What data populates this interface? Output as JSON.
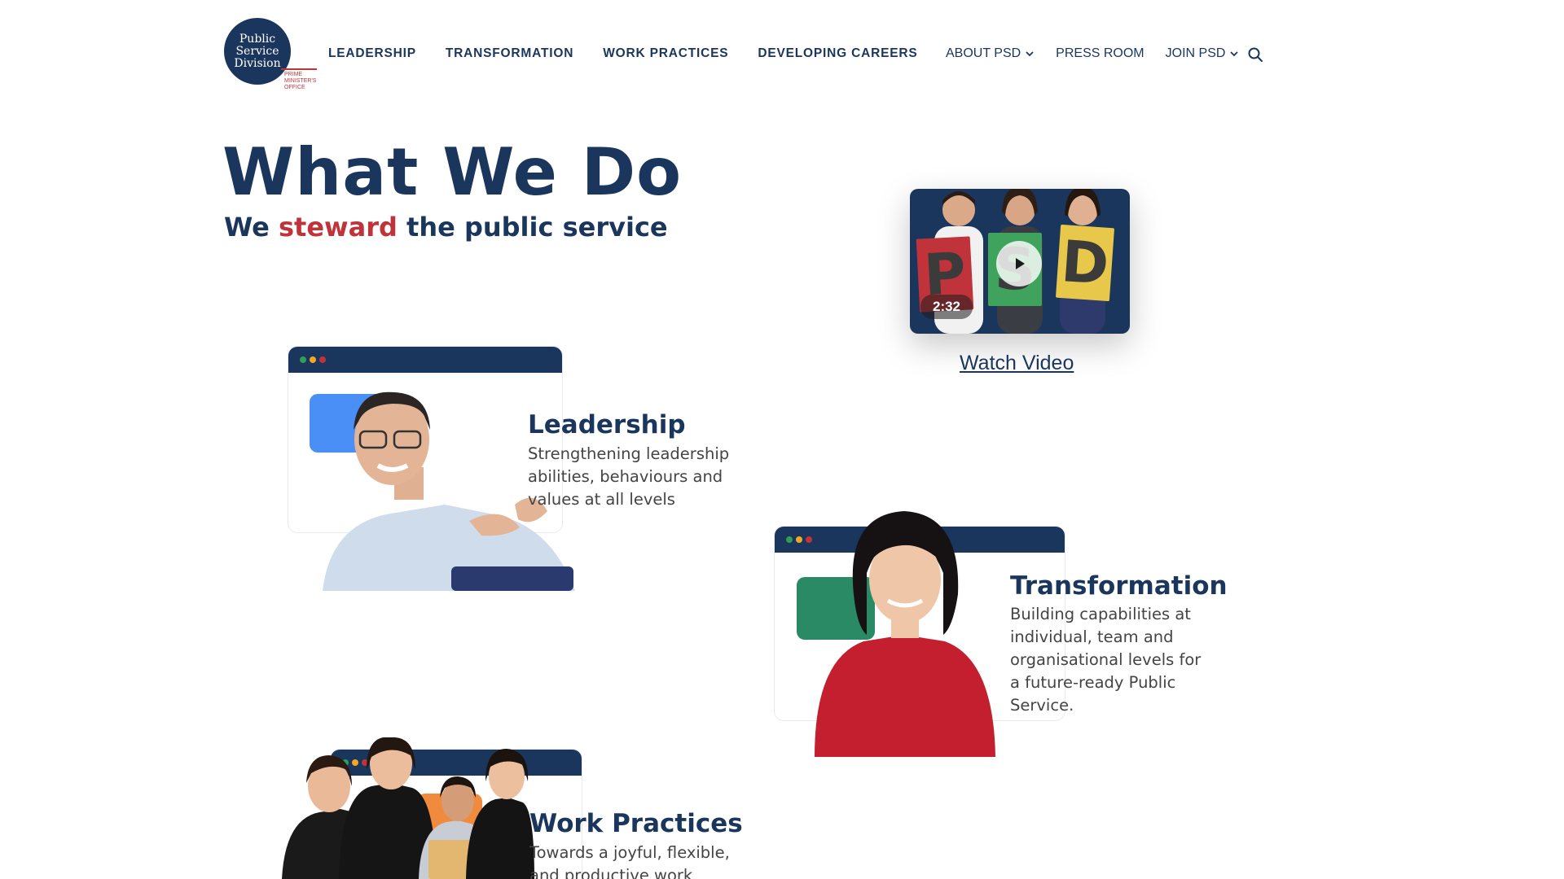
{
  "logo": {
    "lines": [
      "Public",
      "Service",
      "Division"
    ],
    "sub": "PRIME MINISTER'S OFFICE"
  },
  "nav": {
    "main": [
      "LEADERSHIP",
      "TRANSFORMATION",
      "WORK PRACTICES",
      "DEVELOPING CAREERS"
    ],
    "secondary": [
      {
        "label": "ABOUT PSD",
        "dropdown": true
      },
      {
        "label": "PRESS ROOM",
        "dropdown": false
      },
      {
        "label": "JOIN PSD",
        "dropdown": true
      }
    ],
    "search_icon": "search-icon"
  },
  "hero": {
    "title": "What We Do",
    "sub_before": "We ",
    "sub_accent": "steward",
    "sub_after": " the public service"
  },
  "video": {
    "letters": [
      "P",
      "S",
      "D"
    ],
    "duration": "2:32",
    "watch_label": "Watch Video"
  },
  "features": [
    {
      "title": "Leadership",
      "desc": "Strengthening leadership abilities, behaviours and values at all levels",
      "blob_color": "#4a8ff5"
    },
    {
      "title": "Transformation",
      "desc": "Building capabilities at individual, team and organisational levels for a future-ready Public Service.",
      "blob_color": "#2a8a66"
    },
    {
      "title": "Work Practices",
      "desc": "Towards a joyful, flexible, and productive work",
      "blob_color": "#f08a3c"
    }
  ],
  "colors": {
    "navy": "#1b365d",
    "accent_red": "#c0333a",
    "dot_green": "#2e9e5b",
    "dot_orange": "#f5a623",
    "dot_red": "#c0333a"
  }
}
